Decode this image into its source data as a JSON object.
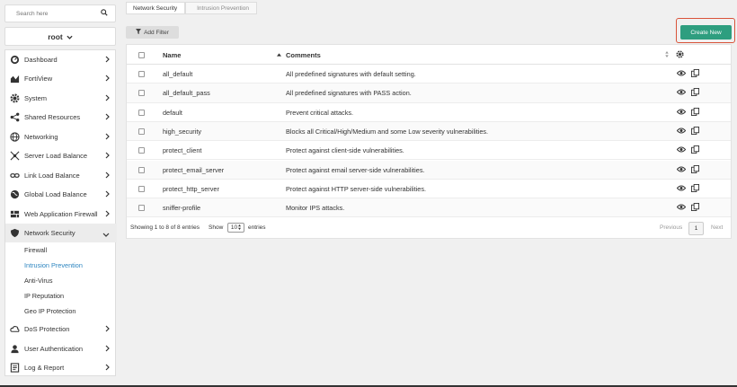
{
  "sidebar": {
    "search_placeholder": "Search here",
    "vdom": "root",
    "menu": [
      {
        "label": "Dashboard",
        "icon": "speedometer-icon"
      },
      {
        "label": "FortiView",
        "icon": "area-chart-icon"
      },
      {
        "label": "System",
        "icon": "gear-icon"
      },
      {
        "label": "Shared Resources",
        "icon": "share-icon"
      },
      {
        "label": "Networking",
        "icon": "globe-icon"
      },
      {
        "label": "Server Load Balance",
        "icon": "network-icon"
      },
      {
        "label": "Link Load Balance",
        "icon": "link-icon"
      },
      {
        "label": "Global Load Balance",
        "icon": "world-icon"
      },
      {
        "label": "Web Application Firewall",
        "icon": "firewall-icon"
      },
      {
        "label": "Network Security",
        "icon": "shield-icon"
      }
    ],
    "submenu": [
      {
        "label": "Firewall"
      },
      {
        "label": "Intrusion Prevention"
      },
      {
        "label": "Anti-Virus"
      },
      {
        "label": "IP Reputation"
      },
      {
        "label": "Geo IP Protection"
      }
    ],
    "menu_after": [
      {
        "label": "DoS Protection",
        "icon": "cloud-icon"
      },
      {
        "label": "User Authentication",
        "icon": "user-icon"
      },
      {
        "label": "Log & Report",
        "icon": "report-icon"
      }
    ]
  },
  "breadcrumb": [
    "Network Security",
    "Intrusion Prevention"
  ],
  "toolbar": {
    "add_filter": "Add Filter",
    "create_new": "Create New"
  },
  "table": {
    "headers": {
      "name": "Name",
      "comments": "Comments"
    },
    "rows": [
      {
        "name": "all_default",
        "comment": "All predefined signatures with default setting."
      },
      {
        "name": "all_default_pass",
        "comment": "All predefined signatures with PASS action."
      },
      {
        "name": "default",
        "comment": "Prevent critical attacks."
      },
      {
        "name": "high_security",
        "comment": "Blocks all Critical/High/Medium and some Low severity vulnerabilities."
      },
      {
        "name": "protect_client",
        "comment": "Protect against client-side vulnerabilities."
      },
      {
        "name": "protect_email_server",
        "comment": "Protect against email server-side vulnerabilities."
      },
      {
        "name": "protect_http_server",
        "comment": "Protect against HTTP server-side vulnerabilities."
      },
      {
        "name": "sniffer-profile",
        "comment": "Monitor IPS attacks."
      }
    ]
  },
  "footer": {
    "showing": "Showing 1 to 8 of 8 entries",
    "show_label": "Show",
    "entries_value": "10",
    "entries_label": "entries",
    "previous": "Previous",
    "page": "1",
    "next": "Next"
  },
  "colors": {
    "accent": "#2e9e7f",
    "active_link": "#2e86c1",
    "highlight": "#d9533a"
  }
}
